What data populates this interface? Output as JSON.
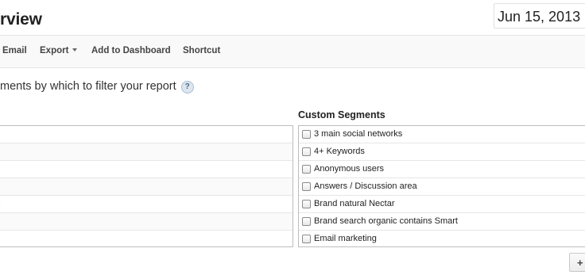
{
  "header": {
    "title": "rview",
    "date_range": "Jun 15, 2013"
  },
  "toolbar": {
    "items": [
      {
        "label": "Email"
      },
      {
        "label": "Export"
      },
      {
        "label": "Add to Dashboard"
      },
      {
        "label": "Shortcut"
      }
    ]
  },
  "instructions": {
    "text": "ments by which to filter your report",
    "help_icon": "?"
  },
  "default_segments": {
    "rows": [
      {
        "label": ""
      },
      {
        "label": ""
      },
      {
        "label": ""
      },
      {
        "label": ""
      },
      {
        "label": ":"
      },
      {
        "label": ""
      },
      {
        "label": ""
      }
    ]
  },
  "custom_segments": {
    "header": "Custom Segments",
    "items": [
      {
        "label": "3 main social networks",
        "checked": false
      },
      {
        "label": "4+ Keywords",
        "checked": false
      },
      {
        "label": "Anonymous users",
        "checked": false
      },
      {
        "label": "Answers / Discussion area",
        "checked": false
      },
      {
        "label": "Brand natural Nectar",
        "checked": false
      },
      {
        "label": "Brand search organic contains Smart",
        "checked": false
      },
      {
        "label": "Email marketing",
        "checked": false
      }
    ]
  },
  "footer": {
    "add_button_label": "+"
  }
}
